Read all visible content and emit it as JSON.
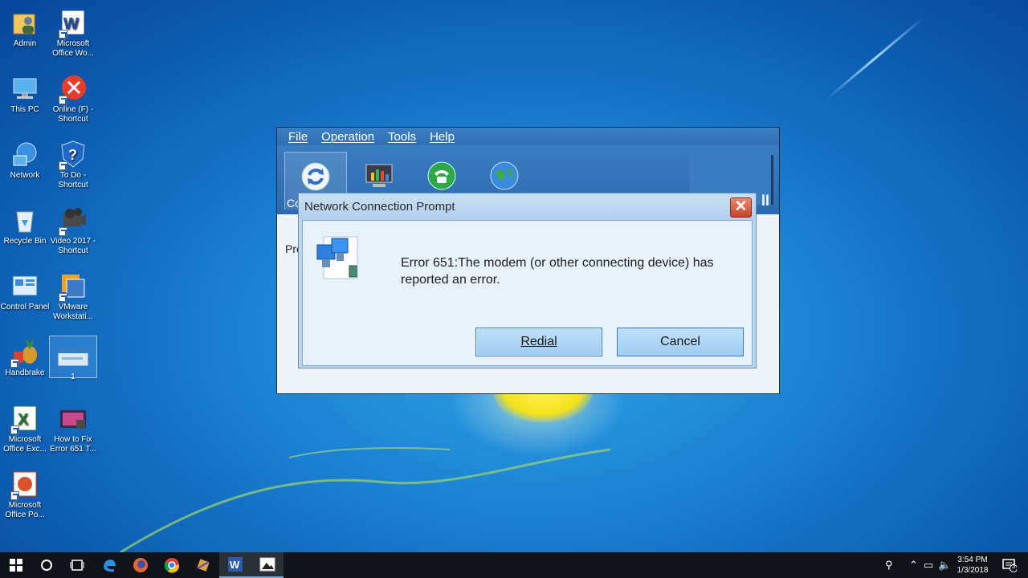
{
  "desktop": {
    "icons": [
      {
        "id": "admin",
        "label": "Admin",
        "icon": "user-folder-icon"
      },
      {
        "id": "word",
        "label": "Microsoft Office Wo...",
        "icon": "word-icon"
      },
      {
        "id": "thispc",
        "label": "This PC",
        "icon": "computer-icon"
      },
      {
        "id": "online",
        "label": "Online (F) - Shortcut",
        "icon": "error-drive-icon"
      },
      {
        "id": "network",
        "label": "Network",
        "icon": "network-icon"
      },
      {
        "id": "todo",
        "label": "To Do - Shortcut",
        "icon": "help-shield-icon"
      },
      {
        "id": "recycle",
        "label": "Recycle Bin",
        "icon": "recycle-bin-icon"
      },
      {
        "id": "video",
        "label": "Video 2017 - Shortcut",
        "icon": "camcorder-icon"
      },
      {
        "id": "control",
        "label": "Control Panel",
        "icon": "control-panel-icon"
      },
      {
        "id": "vmware",
        "label": "VMware Workstati...",
        "icon": "vmware-icon"
      },
      {
        "id": "handbrake",
        "label": "Handbrake",
        "icon": "handbrake-icon"
      },
      {
        "id": "one",
        "label": "1",
        "icon": "window-thumbnail-icon"
      },
      {
        "id": "excel",
        "label": "Microsoft Office Exc...",
        "icon": "excel-icon"
      },
      {
        "id": "howto",
        "label": "How to Fix Error 651 T...",
        "icon": "video-file-icon"
      },
      {
        "id": "ppt",
        "label": "Microsoft Office Po...",
        "icon": "powerpoint-icon"
      }
    ]
  },
  "app": {
    "menu": [
      "File",
      "Operation",
      "Tools",
      "Help"
    ],
    "connect_fragment": "Co",
    "body_fragment": "Pro",
    "toolbar_right_fragment": "ll"
  },
  "dialog": {
    "title": "Network Connection Prompt",
    "close_glyph": "✕",
    "message": "Error 651:The modem (or other connecting device) has reported an error.",
    "redial_label": "Redial",
    "cancel_label": "Cancel"
  },
  "taskbar": {
    "time": "3:54 PM",
    "date": "1/3/2018",
    "notification_count": "3"
  },
  "colors": {
    "desktop_blue": "#1b82d4",
    "app_header": "#2e6fb5",
    "dialog_bg": "#e7f1fa",
    "button_fill": "#bfe0fa",
    "close_red": "#c9432a",
    "taskbar": "#101418"
  }
}
